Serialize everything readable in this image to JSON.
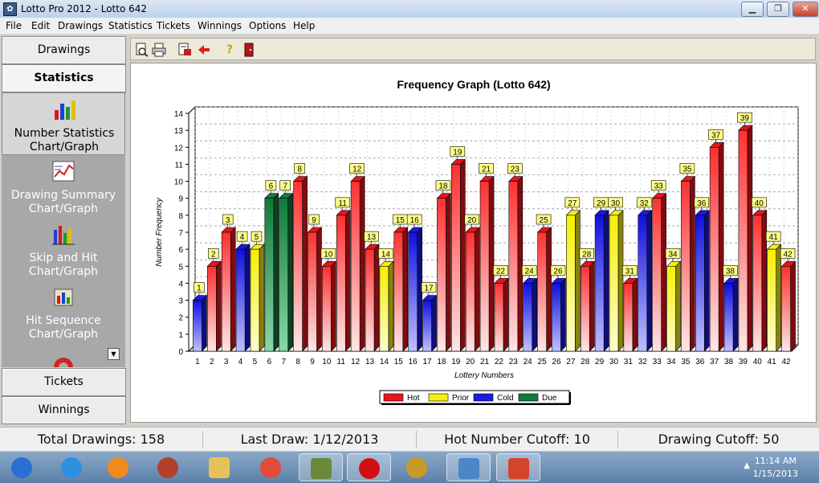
{
  "window": {
    "title": "Lotto Pro 2012 - Lotto 642"
  },
  "menu": [
    "File",
    "Edit",
    "Drawings",
    "Statistics",
    "Tickets",
    "Winnings",
    "Options",
    "Help"
  ],
  "nav": {
    "drawings": "Drawings",
    "statistics": "Statistics",
    "tickets": "Tickets",
    "winnings": "Winnings",
    "items": [
      {
        "label1": "Number Statistics",
        "label2": "Chart/Graph",
        "icon": "bar-chart-icon"
      },
      {
        "label1": "Drawing Summary",
        "label2": "Chart/Graph",
        "icon": "summary-chart-icon"
      },
      {
        "label1": "Skip and Hit",
        "label2": "Chart/Graph",
        "icon": "skip-hit-chart-icon"
      },
      {
        "label1": "Hit Sequence",
        "label2": "Chart/Graph",
        "icon": "hit-sequence-icon"
      }
    ]
  },
  "toolbar": [
    "print-preview-icon",
    "print-icon",
    "export-icon",
    "back-arrow-icon",
    "help-icon",
    "exit-icon"
  ],
  "colors": {
    "Hot": "#e8141c",
    "Prior": "#f4f014",
    "Cold": "#1a1ae0",
    "Due": "#127a3a"
  },
  "chart_data": {
    "type": "bar",
    "title": "Frequency Graph (Lotto 642)",
    "xlabel": "Lottery Numbers",
    "ylabel": "Number Frequency",
    "ylim": [
      0,
      14
    ],
    "yticks": [
      0,
      1,
      2,
      3,
      4,
      5,
      6,
      7,
      8,
      9,
      10,
      11,
      12,
      13,
      14
    ],
    "grid": true,
    "categories": [
      "1",
      "2",
      "3",
      "4",
      "5",
      "6",
      "7",
      "8",
      "9",
      "10",
      "11",
      "12",
      "13",
      "14",
      "15",
      "16",
      "17",
      "18",
      "19",
      "20",
      "21",
      "22",
      "23",
      "24",
      "25",
      "26",
      "27",
      "28",
      "29",
      "30",
      "31",
      "32",
      "33",
      "34",
      "35",
      "36",
      "37",
      "38",
      "39",
      "40",
      "41",
      "42"
    ],
    "values": [
      3,
      5,
      7,
      6,
      6,
      9,
      9,
      10,
      7,
      5,
      8,
      10,
      6,
      5,
      7,
      7,
      3,
      9,
      11,
      7,
      10,
      4,
      10,
      4,
      7,
      4,
      8,
      5,
      8,
      8,
      4,
      8,
      9,
      5,
      10,
      8,
      12,
      4,
      13,
      8,
      6,
      5
    ],
    "groups": [
      "Cold",
      "Hot",
      "Hot",
      "Cold",
      "Prior",
      "Due",
      "Due",
      "Hot",
      "Hot",
      "Hot",
      "Hot",
      "Hot",
      "Hot",
      "Prior",
      "Hot",
      "Cold",
      "Cold",
      "Hot",
      "Hot",
      "Hot",
      "Hot",
      "Hot",
      "Hot",
      "Cold",
      "Hot",
      "Cold",
      "Prior",
      "Hot",
      "Cold",
      "Prior",
      "Hot",
      "Cold",
      "Hot",
      "Prior",
      "Hot",
      "Cold",
      "Hot",
      "Cold",
      "Hot",
      "Hot",
      "Prior",
      "Hot"
    ],
    "legend": [
      "Hot",
      "Prior",
      "Cold",
      "Due"
    ],
    "legend_position": "bottom-center"
  },
  "status": {
    "total_drawings": "Total Drawings: 158",
    "last_draw": "Last Draw: 1/12/2013",
    "hot_cutoff": "Hot Number Cutoff: 10",
    "drawing_cutoff": "Drawing Cutoff: 50"
  },
  "taskbar": {
    "apps": [
      {
        "name": "start-orb",
        "color": "#2a6fd1"
      },
      {
        "name": "internet-explorer",
        "color": "#2f8fe0"
      },
      {
        "name": "media-player",
        "color": "#f08a1c"
      },
      {
        "name": "film-reel",
        "color": "#b5402a"
      },
      {
        "name": "file-explorer",
        "color": "#e7c25a"
      },
      {
        "name": "chrome",
        "color": "#e24a3b"
      },
      {
        "name": "money-app",
        "color": "#6a8a3a"
      },
      {
        "name": "red-ball-app",
        "color": "#d01010"
      },
      {
        "name": "lotto-app",
        "color": "#c89a2a"
      },
      {
        "name": "control-panel",
        "color": "#4a86c8"
      },
      {
        "name": "powerpoint",
        "color": "#d2452b"
      }
    ],
    "time": "11:14 AM",
    "date": "1/15/2013"
  }
}
